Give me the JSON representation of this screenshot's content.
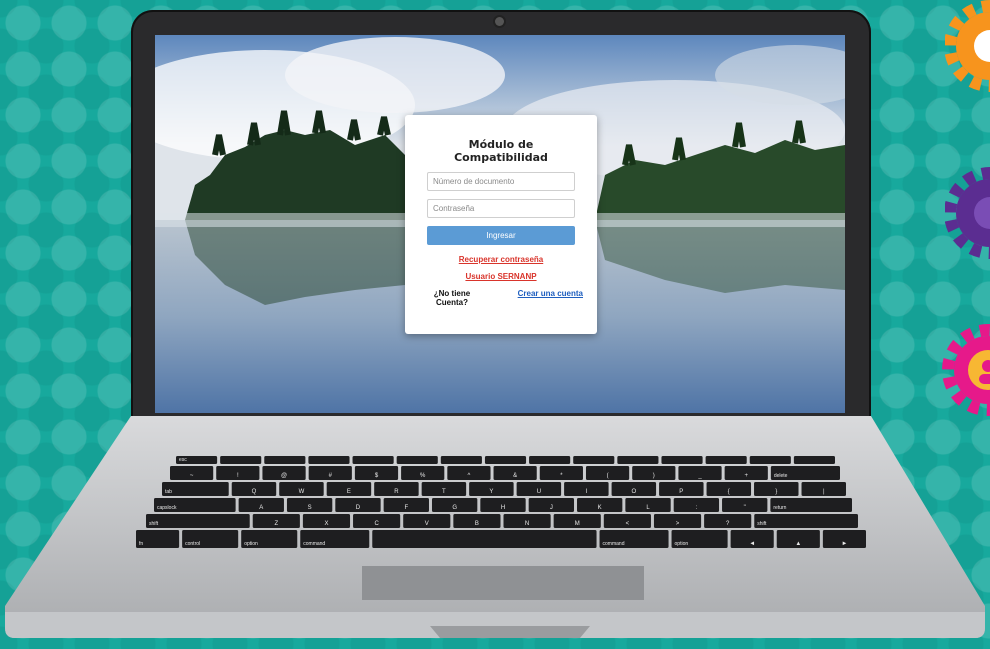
{
  "login": {
    "title": "Módulo de Compatibilidad",
    "document_placeholder": "Número de documento",
    "password_placeholder": "Contraseña",
    "submit_label": "Ingresar",
    "recover_link": "Recuperar contraseña",
    "sernanp_link": "Usuario SERNANP",
    "no_account": "¿No tiene Cuenta?",
    "create_account_link": "Crear una cuenta"
  },
  "keyboard": {
    "rows": [
      [
        "esc",
        "",
        "",
        "",
        "",
        "",
        "",
        "",
        "",
        "",
        "",
        "",
        "",
        "",
        ""
      ],
      [
        "~",
        "!",
        "@",
        "#",
        "$",
        "%",
        "^",
        "&",
        "*",
        "(",
        ")",
        "_",
        "+",
        "delete"
      ],
      [
        "tab",
        "Q",
        "W",
        "E",
        "R",
        "T",
        "Y",
        "U",
        "I",
        "O",
        "P",
        "{",
        "}",
        "|"
      ],
      [
        "capslock",
        "A",
        "S",
        "D",
        "F",
        "G",
        "H",
        "J",
        "K",
        "L",
        ":",
        "\"",
        "return"
      ],
      [
        "shift",
        "Z",
        "X",
        "C",
        "V",
        "B",
        "N",
        "M",
        "<",
        ">",
        "?",
        "shift"
      ],
      [
        "fn",
        "control",
        "option",
        "command",
        "",
        "command",
        "option",
        "◄",
        "▲",
        "►"
      ]
    ]
  },
  "colors": {
    "background": "#17a99d",
    "gear_orange": "#f7941d",
    "gear_purple": "#5b2d91",
    "gear_pink": "#e6198a",
    "button_blue": "#5b9bd5",
    "link_red": "#d9342b",
    "link_blue": "#1f5fbf"
  },
  "icons": [
    "gear-icon-orange",
    "gear-icon-purple",
    "gear-icon-pink",
    "camera-icon"
  ]
}
